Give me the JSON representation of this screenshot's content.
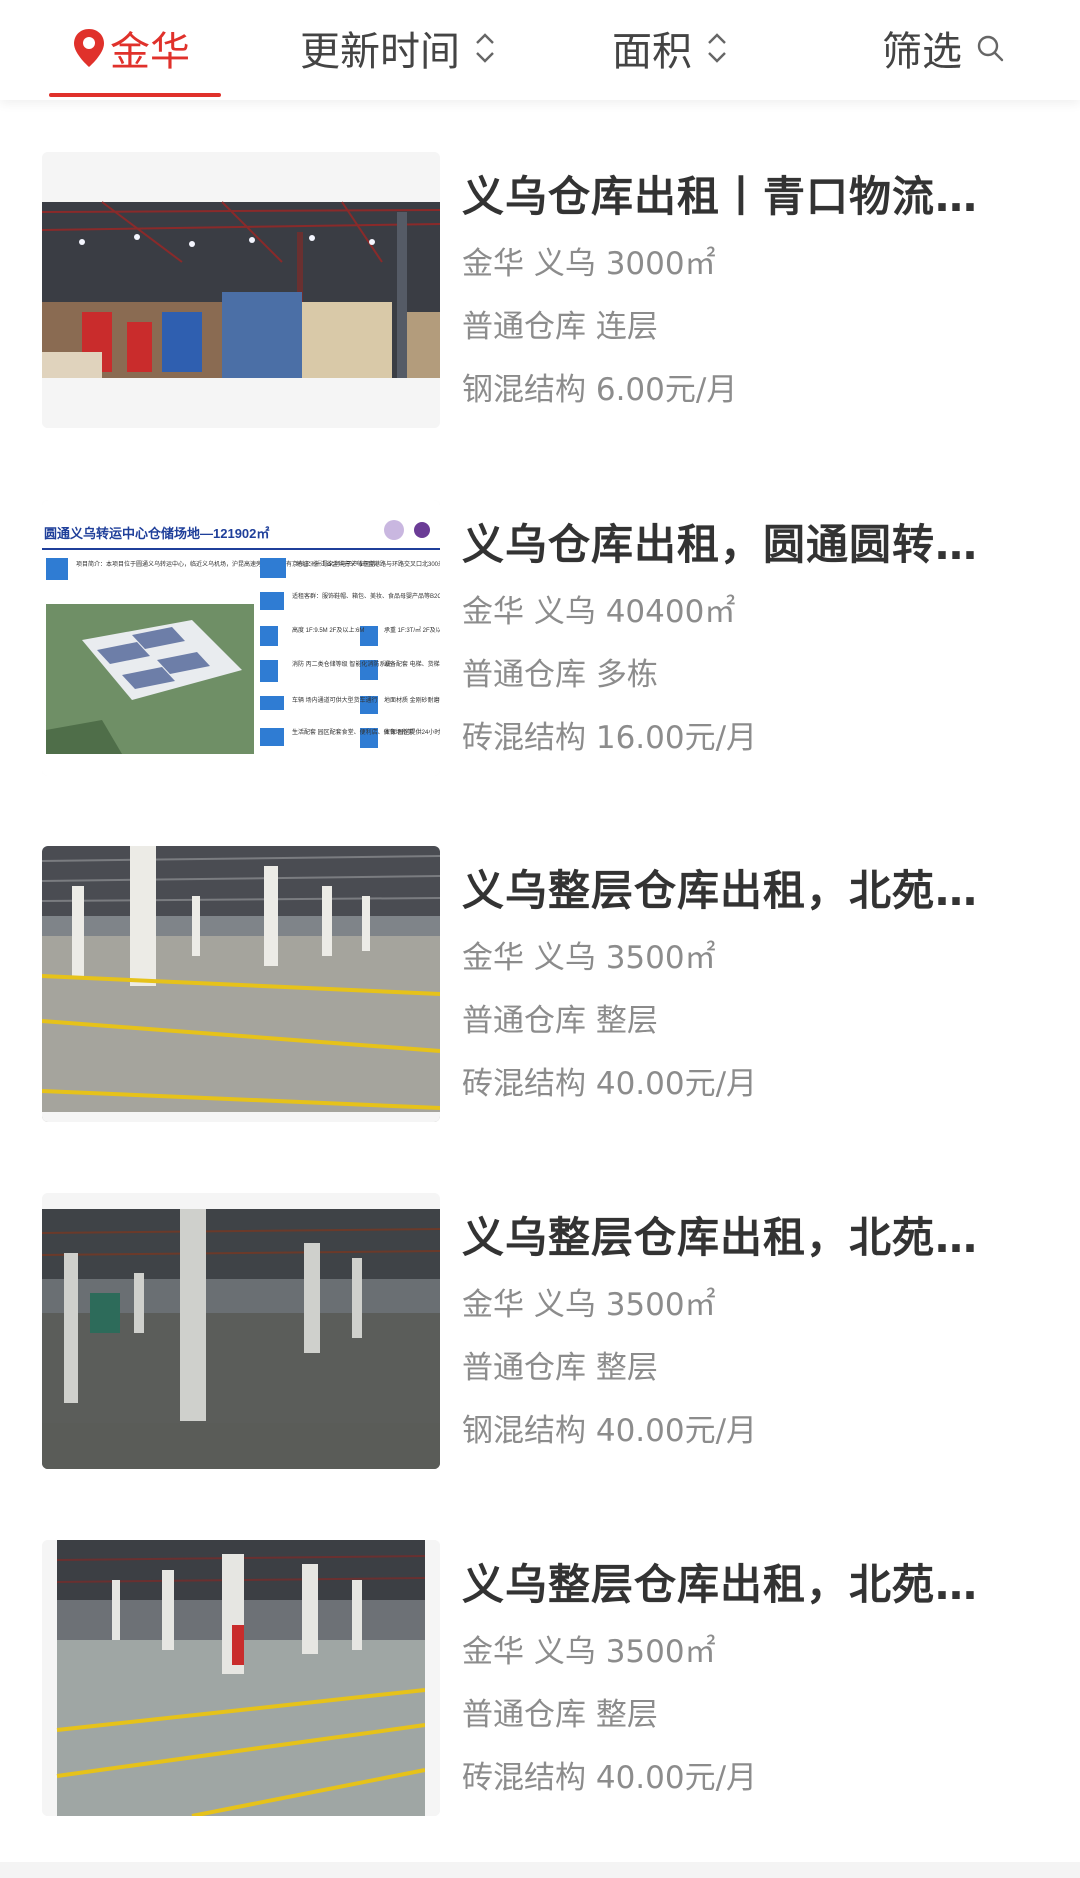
{
  "filters": {
    "city": "金华",
    "update_time": "更新时间",
    "area": "面积",
    "filter": "筛选"
  },
  "listings": [
    {
      "title": "义乌仓库出租丨青口物流…",
      "location_size": "金华 义乌 3000㎡",
      "type": "普通仓库 连层",
      "structure_price": "钢混结构 6.00元/月"
    },
    {
      "title": "义乌仓库出租，圆通圆转…",
      "location_size": "金华 义乌 40400㎡",
      "type": "普通仓库 多栋",
      "structure_price": "砖混结构 16.00元/月",
      "image_texts": {
        "banner_title": "圆通义乌转运中心仓储场地—121902㎡",
        "intro": "项目简介：本项目位于圆通义乌转运中心，临近义乌机场，沪昆高速旁边，周边有京东亚洲一号义乌电子产业园等。",
        "address": "地址：浙江省金华市义乌市宝港路与环路交叉口北300米",
        "goods": "适租客群：服饰鞋帽、箱包、美妆、食品母婴产品等B2C业务",
        "height": "高度 1F:9.5M 2F及以上:6M",
        "load": "承重 1F:3T/㎡ 2F及以上:0.8T/㎡",
        "fire": "消防 丙二类仓储等级 智能化消防系统",
        "equipment": "设备配套 电梯、货梯、月台、雨棚等",
        "vehicle": "车辆 场内通道可供大型货车通行",
        "floor": "地面材质 金刚砂耐磨地面",
        "life": "生活配套 园区配套食堂、便利店、体育场所等",
        "security": "安保 园区提供24小时安全巡护"
      }
    },
    {
      "title": "义乌整层仓库出租，北苑…",
      "location_size": "金华 义乌 3500㎡",
      "type": "普通仓库 整层",
      "structure_price": "砖混结构 40.00元/月"
    },
    {
      "title": "义乌整层仓库出租，北苑…",
      "location_size": "金华 义乌 3500㎡",
      "type": "普通仓库 整层",
      "structure_price": "钢混结构 40.00元/月"
    },
    {
      "title": "义乌整层仓库出租，北苑…",
      "location_size": "金华 义乌 3500㎡",
      "type": "普通仓库 整层",
      "structure_price": "砖混结构 40.00元/月"
    }
  ],
  "colors": {
    "accent": "#e0312b",
    "title_text": "#333333",
    "meta_text": "#8c8c8c",
    "floor_line": "#e6c21a"
  },
  "icons": [
    "location-pin-icon",
    "sort-arrows-icon",
    "search-icon"
  ]
}
